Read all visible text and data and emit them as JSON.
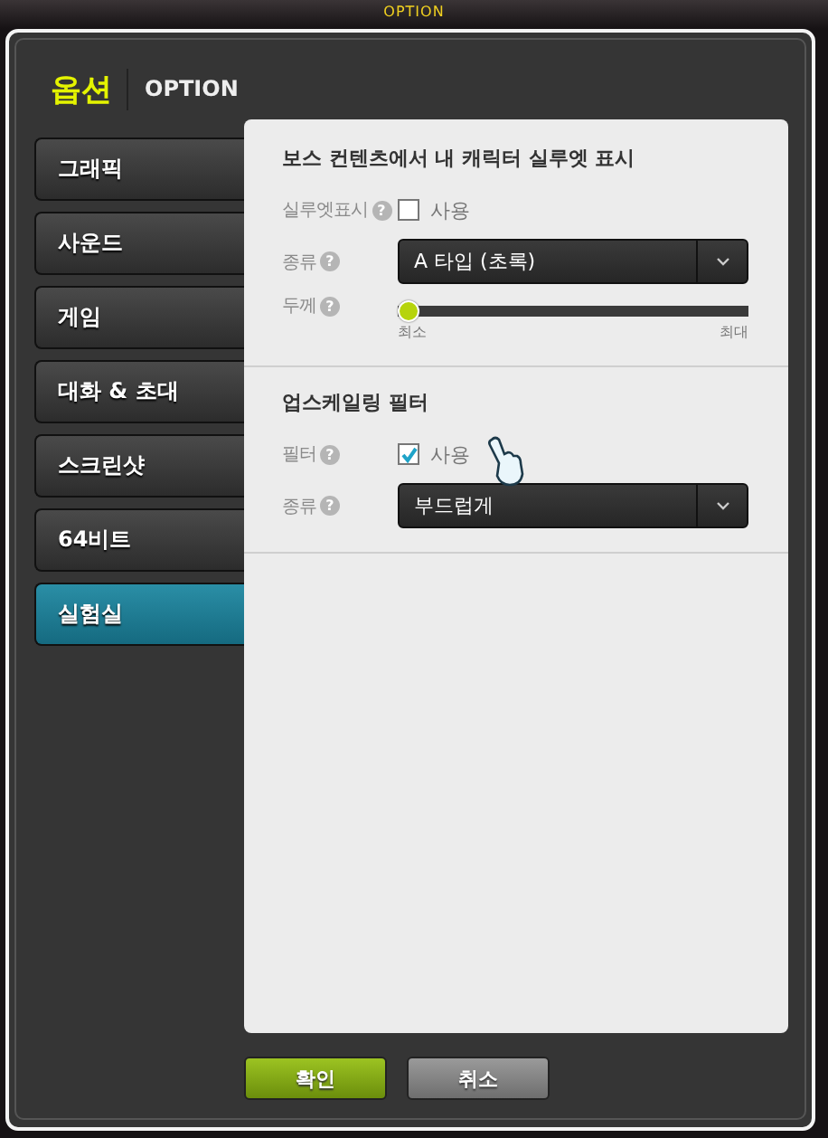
{
  "window": {
    "title": "OPTION"
  },
  "header": {
    "title": "옵션",
    "subtitle": "OPTION"
  },
  "sidebar": {
    "items": [
      {
        "label": "그래픽",
        "selected": false
      },
      {
        "label": "사운드",
        "selected": false
      },
      {
        "label": "게임",
        "selected": false
      },
      {
        "label": "대화 & 초대",
        "selected": false
      },
      {
        "label": "스크린샷",
        "selected": false
      },
      {
        "label": "64비트",
        "selected": false
      },
      {
        "label": "실험실",
        "selected": true
      }
    ]
  },
  "sections": [
    {
      "title": "보스 컨텐츠에서 내 캐릭터 실루엣 표시",
      "rows": [
        {
          "kind": "checkbox",
          "label": "실루엣표시",
          "help": "?",
          "option": "사용",
          "checked": false
        },
        {
          "kind": "dropdown",
          "label": "종류",
          "help": "?",
          "value": "A 타입 (초록)"
        },
        {
          "kind": "slider",
          "label": "두께",
          "help": "?",
          "level": 0,
          "min_label": "최소",
          "max_label": "최대"
        }
      ]
    },
    {
      "title": "업스케일링 필터",
      "rows": [
        {
          "kind": "checkbox",
          "label": "필터",
          "help": "?",
          "option": "사용",
          "checked": true
        },
        {
          "kind": "dropdown",
          "label": "종류",
          "help": "?",
          "value": "부드럽게"
        }
      ]
    }
  ],
  "buttons": [
    {
      "label": "확인",
      "kind": "primary"
    },
    {
      "label": "취소",
      "kind": "secondary"
    }
  ]
}
